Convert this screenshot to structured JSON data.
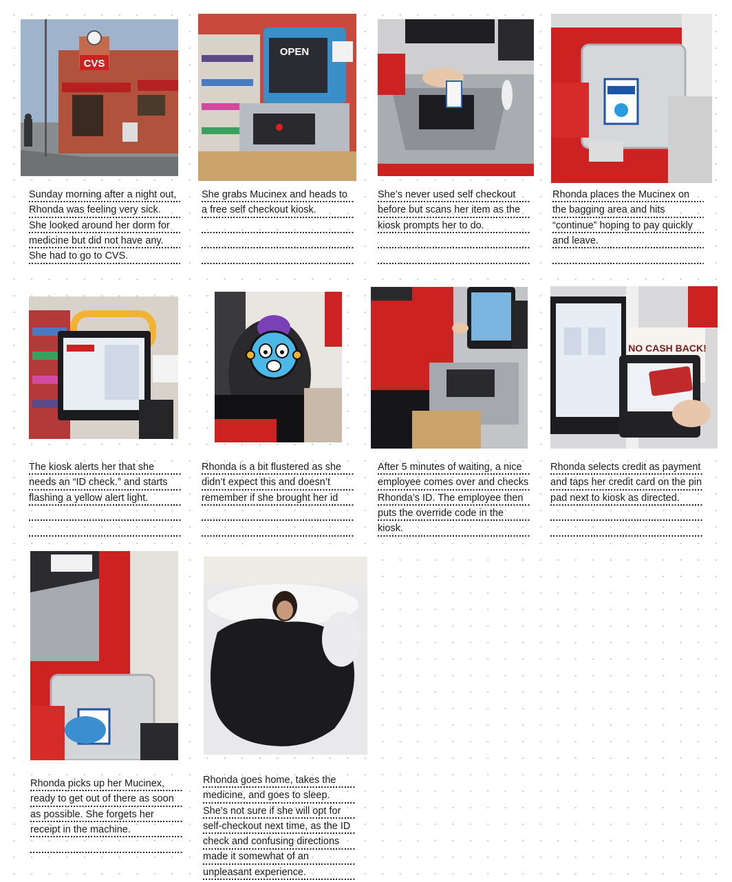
{
  "panels": [
    {
      "id": "p1",
      "icon": "storefront-photo",
      "caption": "Sunday morning after a night out, Rhonda was feeling very sick. She looked around her dorm for medicine but did not have any. She had to go to CVS."
    },
    {
      "id": "p2",
      "icon": "kiosk-photo",
      "caption": "She grabs Mucinex and heads to a free self checkout kiosk."
    },
    {
      "id": "p3",
      "icon": "scan-photo",
      "caption": "She’s never used self checkout before but scans her item as the kiosk prompts her to do."
    },
    {
      "id": "p4",
      "icon": "bagging-photo",
      "caption": "Rhonda places the Mucinex on the bagging area and hits “continue” hoping to pay quickly and leave."
    },
    {
      "id": "p5",
      "icon": "alert-photo",
      "caption": "The kiosk alerts her that she needs an “ID check.” and starts flashing a yellow alert light."
    },
    {
      "id": "p6",
      "icon": "flustered-photo",
      "caption": "Rhonda is a bit flustered as she didn’t expect this and doesn’t remember if she brought her id"
    },
    {
      "id": "p7",
      "icon": "employee-photo",
      "caption": "After 5 minutes of waiting, a nice employee comes over and checks Rhonda’s ID. The employee then puts the override code in the kiosk."
    },
    {
      "id": "p8",
      "icon": "payment-photo",
      "caption": "Rhonda selects credit as payment and taps her credit card on the pin pad next to kiosk as directed."
    },
    {
      "id": "p9",
      "icon": "pickup-photo",
      "caption": "Rhonda picks up her Mucinex, ready to get out of there as soon as possible. She forgets her receipt in the machine."
    },
    {
      "id": "p10",
      "icon": "sleep-photo",
      "caption": "Rhonda goes home, takes the medicine, and goes to sleep. She’s not sure if she will opt for self-checkout next time, as the ID check and confusing directions made it somewhat of an unpleasant experience."
    }
  ],
  "photo_text": {
    "store_sign": "CVS",
    "kiosk_screen": "OPEN",
    "no_cash_back": "NO CASH BACK!"
  },
  "colors": {
    "cvs_red": "#cc2222",
    "kiosk_steel": "#9aa0a6",
    "screen_blue": "#2c5f9e",
    "alert_yellow": "#f2b233"
  }
}
